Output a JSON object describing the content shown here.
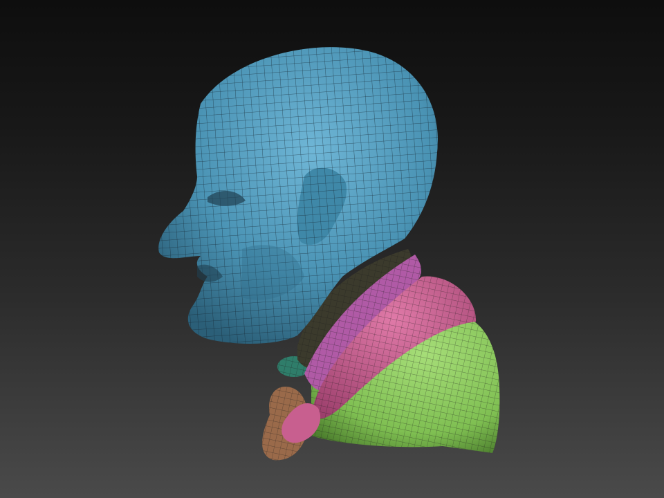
{
  "viewport": {
    "background_top": "#0e0e0e",
    "background_bottom": "#4a4a4a"
  },
  "model": {
    "polygroups": [
      {
        "part": "head",
        "color": "#4a93b4"
      },
      {
        "part": "collar",
        "color": "#3b3a2c"
      },
      {
        "part": "scarf",
        "color": "#b05aa6"
      },
      {
        "part": "scarf-fold",
        "color": "#c85f8f"
      },
      {
        "part": "jacket",
        "color": "#7fbf52"
      },
      {
        "part": "tie",
        "color": "#2f7d6a"
      },
      {
        "part": "bow",
        "color": "#9a6a4a"
      }
    ],
    "wire_color": "#1c2a33"
  }
}
